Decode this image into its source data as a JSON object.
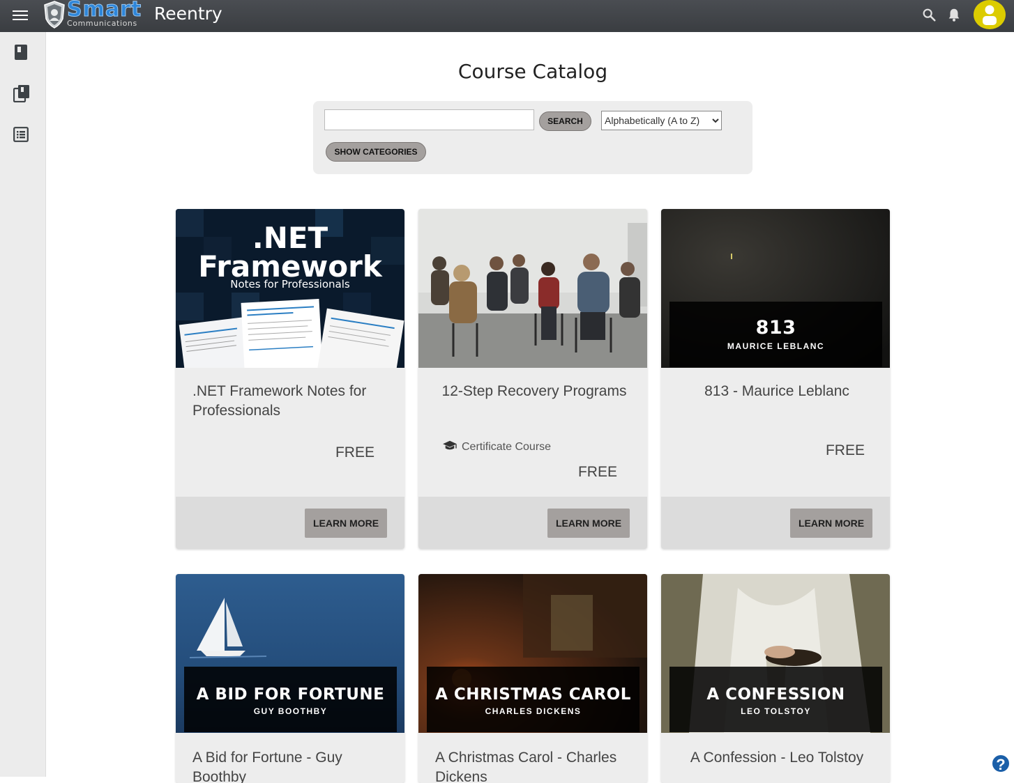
{
  "header": {
    "logo_main": "Smart",
    "logo_sub": "Communications",
    "app_title": "Reentry",
    "icons": [
      "menu-icon",
      "search-icon",
      "bell-icon",
      "user-avatar-icon"
    ]
  },
  "sidebar": {
    "items": [
      {
        "icon": "book-icon"
      },
      {
        "icon": "library-icon"
      },
      {
        "icon": "list-icon"
      }
    ]
  },
  "catalog": {
    "title": "Course Catalog",
    "search_placeholder": "",
    "search_label": "SEARCH",
    "sort_selected": "Alphabetically (A to Z)",
    "categories_label": "SHOW CATEGORIES"
  },
  "courses": [
    {
      "cover_line1": ".NET",
      "cover_line2": "Framework",
      "cover_line3": "Notes for Professionals",
      "title": ".NET Framework Notes for Professionals",
      "price": "FREE",
      "learn_more": "LEARN MORE"
    },
    {
      "title": "12-Step Recovery Programs",
      "certificate": "Certificate Course",
      "price": "FREE",
      "learn_more": "LEARN MORE"
    },
    {
      "cover_title": "813",
      "cover_author": "MAURICE LEBLANC",
      "title": "813 - Maurice Leblanc",
      "price": "FREE",
      "learn_more": "LEARN MORE"
    },
    {
      "cover_title": "A BID FOR FORTUNE",
      "cover_author": "GUY BOOTHBY",
      "title": "A Bid for Fortune - Guy Boothby"
    },
    {
      "cover_title": "A CHRISTMAS CAROL",
      "cover_author": "CHARLES DICKENS",
      "title": "A Christmas Carol - Charles Dickens"
    },
    {
      "cover_title": "A CONFESSION",
      "cover_author": "LEO TOLSTOY",
      "title": "A Confession - Leo Tolstoy"
    }
  ],
  "help": {
    "label": "?"
  },
  "colors": {
    "topbar": "#3f4246",
    "accent_blue": "#2e86d9",
    "avatar": "#dccc00",
    "button_grey": "#a4a09e"
  }
}
